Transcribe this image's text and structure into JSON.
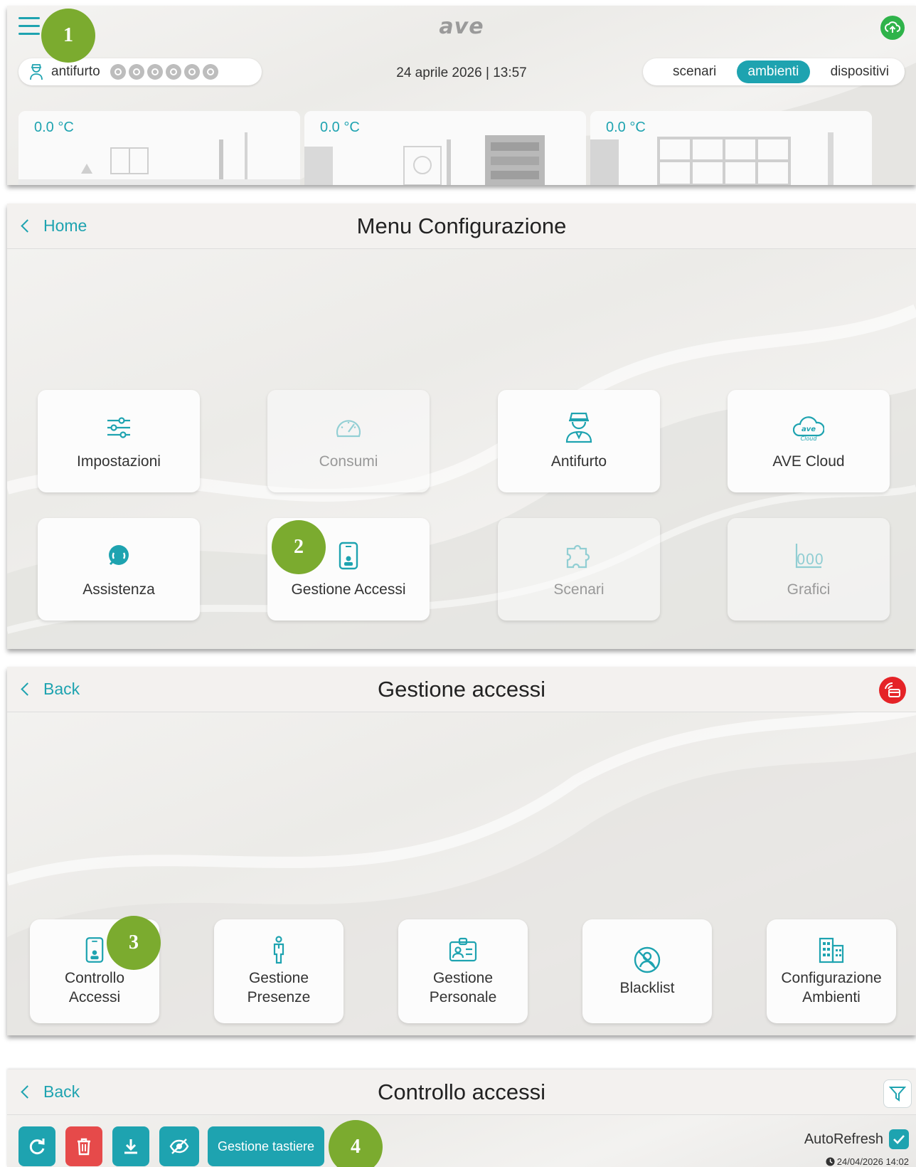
{
  "home": {
    "logo": "ave",
    "alarm_label": "antifurto",
    "alarm_zones": 6,
    "datetime": "24 aprile 2026 | 13:57",
    "view_options": [
      "scenari",
      "ambienti",
      "dispositivi"
    ],
    "view_selected": "ambienti",
    "rooms": [
      {
        "temp": "0.0 °C"
      },
      {
        "temp": "0.0 °C"
      },
      {
        "temp": "0.0 °C"
      }
    ]
  },
  "menu_config": {
    "back_label": "Home",
    "title": "Menu Configurazione",
    "tiles": [
      {
        "label": "Impostazioni",
        "icon": "sliders-icon",
        "enabled": true
      },
      {
        "label": "Consumi",
        "icon": "gauge-icon",
        "enabled": false
      },
      {
        "label": "Antifurto",
        "icon": "guard-icon",
        "enabled": true
      },
      {
        "label": "AVE Cloud",
        "icon": "ave-cloud-icon",
        "enabled": true
      },
      {
        "label": "Assistenza",
        "icon": "headset-icon",
        "enabled": true
      },
      {
        "label": "Gestione Accessi",
        "icon": "badge-reader-icon",
        "enabled": true
      },
      {
        "label": "Scenari",
        "icon": "puzzle-icon",
        "enabled": false
      },
      {
        "label": "Grafici",
        "icon": "bar-chart-icon",
        "enabled": false
      }
    ],
    "ave_cloud_icon_text": {
      "top": "ave",
      "bottom": "Cloud"
    },
    "grafici_icon_text": "000"
  },
  "gestione_accessi": {
    "back_label": "Back",
    "title": "Gestione accessi",
    "tiles": [
      {
        "line1": "Controllo",
        "line2": "Accessi",
        "icon": "badge-reader-icon"
      },
      {
        "line1": "Gestione",
        "line2": "Presenze",
        "icon": "person-icon"
      },
      {
        "line1": "Gestione",
        "line2": "Personale",
        "icon": "id-card-icon"
      },
      {
        "line1": "Blacklist",
        "line2": "",
        "icon": "blocked-icon"
      },
      {
        "line1": "Configurazione",
        "line2": "Ambienti",
        "icon": "building-icon"
      }
    ]
  },
  "controllo_accessi": {
    "back_label": "Back",
    "title": "Controllo accessi",
    "keypad_button": "Gestione tastiere",
    "autorefresh_label": "AutoRefresh",
    "timestamp": "24/04/2026 14:02"
  },
  "steps": [
    "1",
    "2",
    "3",
    "4"
  ],
  "colors": {
    "accent": "#1ea3b0",
    "step_badge": "#7bab2f",
    "delete": "#e64a4a",
    "rfid": "#e52327",
    "cloud": "#2fb34a"
  }
}
